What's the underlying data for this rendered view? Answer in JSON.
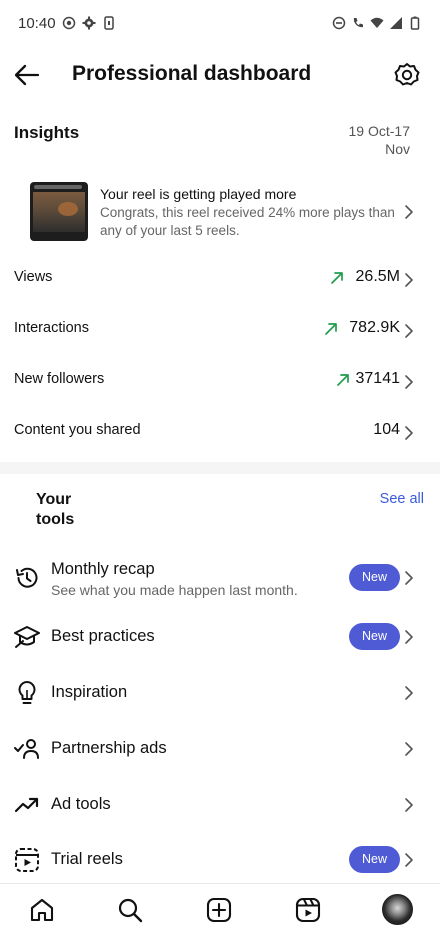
{
  "status_bar": {
    "time": "10:40",
    "left_icons": [
      "camera-icon",
      "gear-icon",
      "phone-icon"
    ],
    "right_icons": [
      "do-not-disturb-icon",
      "wifi-calling-icon",
      "wifi-icon",
      "signal-icon",
      "battery-icon"
    ]
  },
  "header": {
    "title": "Professional dashboard",
    "back_icon": "arrow-left-icon",
    "settings_icon": "gear-icon"
  },
  "insights": {
    "title": "Insights",
    "date_range": "19 Oct-17 Nov",
    "reel": {
      "headline": "Your reel is getting played more",
      "description": "Congrats, this reel received 24% more plays than any of your last 5 reels."
    },
    "metrics": [
      {
        "label": "Views",
        "value": "26.5M",
        "trend": "up"
      },
      {
        "label": "Interactions",
        "value": "782.9K",
        "trend": "up"
      },
      {
        "label": "New followers",
        "value": "37141",
        "trend": "up"
      },
      {
        "label": "Content you shared",
        "value": "104",
        "trend": "none"
      }
    ]
  },
  "tools": {
    "title": "Your tools",
    "see_all": "See all",
    "items": [
      {
        "label": "Monthly recap",
        "sublabel": "See what you made happen last month.",
        "badge": "New",
        "icon": "history-icon"
      },
      {
        "label": "Best practices",
        "badge": "New",
        "icon": "graduation-cap-icon"
      },
      {
        "label": "Inspiration",
        "icon": "lightbulb-icon"
      },
      {
        "label": "Partnership ads",
        "icon": "partnership-icon"
      },
      {
        "label": "Ad tools",
        "icon": "trending-up-icon"
      },
      {
        "label": "Trial reels",
        "badge": "New",
        "icon": "trial-reels-icon"
      }
    ]
  },
  "bottom_nav": {
    "items": [
      "home-icon",
      "search-icon",
      "create-icon",
      "reels-icon",
      "profile-avatar"
    ]
  },
  "colors": {
    "accent": "#4f5bd5",
    "link": "#3b5bdb",
    "trend_up": "#1f9d4d"
  }
}
